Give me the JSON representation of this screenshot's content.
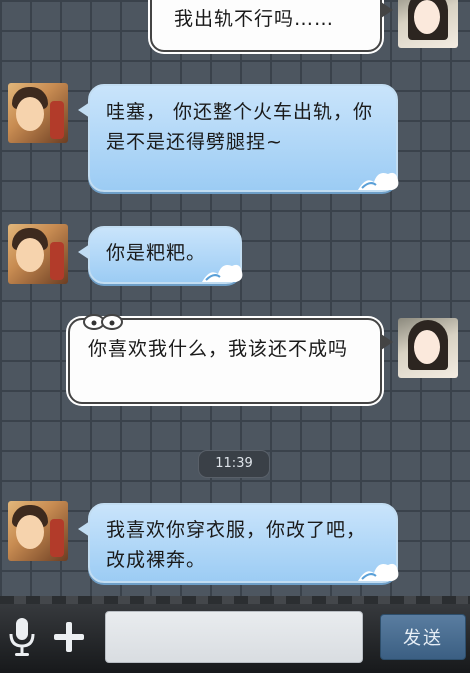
{
  "messages": [
    {
      "side": "right",
      "text": "我出轨不行吗……",
      "sender": "girl"
    },
    {
      "side": "left",
      "text": "哇塞，        你还整个火车出轨，你是不是还得劈腿捏~",
      "sender": "boy"
    },
    {
      "side": "left",
      "text": "你是粑粑。",
      "sender": "boy"
    },
    {
      "side": "right",
      "text": "你喜欢我什么，我该还不成吗",
      "sender": "girl"
    },
    {
      "side": "left",
      "text": "我喜欢你穿衣服，你改了吧，改成裸奔。",
      "sender": "boy"
    }
  ],
  "timestamp": "11:39",
  "input": {
    "value": "",
    "placeholder": ""
  },
  "send_label": "发送",
  "icons": {
    "mic": "microphone-icon",
    "plus": "plus-icon"
  },
  "colors": {
    "left_bubble": "#b4d8f8",
    "right_bubble": "#fdfdfd",
    "send_button": "#46698d"
  }
}
